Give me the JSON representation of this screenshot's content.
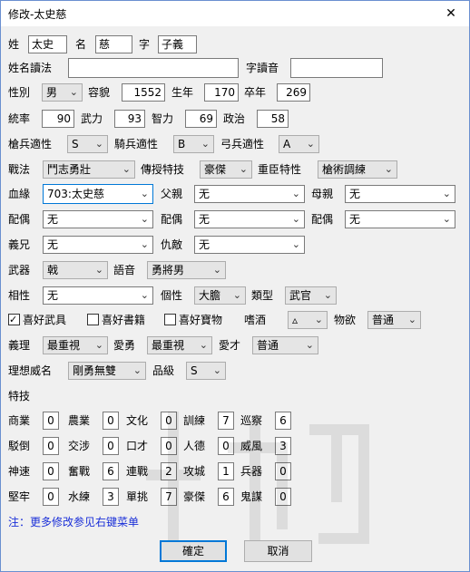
{
  "window": {
    "title": "修改-太史慈",
    "close_glyph": "✕"
  },
  "icons": {
    "dropdown_arrow": "chevron-down-icon",
    "close": "close-icon"
  },
  "row1": {
    "xing_label": "姓",
    "xing": "太史",
    "ming_label": "名",
    "ming": "慈",
    "zi_label": "字",
    "zi": "子義"
  },
  "row2": {
    "name_read_label": "姓名讀法",
    "name_read": "",
    "zi_read_label": "字讀音",
    "zi_read": ""
  },
  "row3": {
    "gender_label": "性別",
    "gender": "男",
    "appearance_label": "容貌",
    "appearance": "1552",
    "birth_label": "生年",
    "birth": "170",
    "death_label": "卒年",
    "death": "269"
  },
  "row4": {
    "lead_label": "統率",
    "lead": "90",
    "war_label": "武力",
    "war": "93",
    "int_label": "智力",
    "int": "69",
    "pol_label": "政治",
    "pol": "58"
  },
  "row5": {
    "spear_label": "槍兵適性",
    "spear": "S",
    "cav_label": "騎兵適性",
    "cav": "B",
    "bow_label": "弓兵適性",
    "bow": "A"
  },
  "row6": {
    "tactic_label": "戰法",
    "tactic": "鬥志勇壯",
    "teach_label": "傳授特技",
    "teach": "豪傑",
    "heavy_label": "重臣特性",
    "heavy": "槍術調練"
  },
  "row7": {
    "blood_label": "血緣",
    "blood": "703:太史慈",
    "father_label": "父親",
    "father": "无",
    "mother_label": "母親",
    "mother": "无"
  },
  "row8": {
    "spouse_label": "配偶",
    "spouse1": "无",
    "spouse2": "无",
    "spouse3": "无"
  },
  "row9": {
    "sworn_label": "義兄",
    "sworn": "无",
    "enemy_label": "仇敵",
    "enemy": "无"
  },
  "row10": {
    "weapon_label": "武器",
    "weapon": "戟",
    "voice_label": "語音",
    "voice": "勇將男"
  },
  "row11": {
    "affinity_label": "相性",
    "affinity": "无",
    "personality_label": "個性",
    "personality": "大膽",
    "type_label": "類型",
    "type": "武官"
  },
  "row12": {
    "like_weapon": "喜好武具",
    "like_weapon_checked": true,
    "like_book": "喜好書籍",
    "like_treasure": "喜好寶物",
    "drink_label": "嗜酒",
    "drink": "▵",
    "desire_label": "物欲",
    "desire": "普通"
  },
  "row13": {
    "justice_label": "義理",
    "justice": "最重視",
    "brave_label": "愛勇",
    "brave": "最重視",
    "talent_label": "愛才",
    "talent": "普通"
  },
  "row14": {
    "ideal_label": "理想威名",
    "ideal": "剛勇無雙",
    "grade_label": "品級",
    "grade": "S"
  },
  "skills": {
    "header": "特技",
    "rows": [
      [
        {
          "name": "商業",
          "value": "0"
        },
        {
          "name": "農業",
          "value": "0"
        },
        {
          "name": "文化",
          "value": "0"
        },
        {
          "name": "訓練",
          "value": "7"
        },
        {
          "name": "巡察",
          "value": "6"
        }
      ],
      [
        {
          "name": "駁倒",
          "value": "0"
        },
        {
          "name": "交涉",
          "value": "0"
        },
        {
          "name": "口才",
          "value": "0"
        },
        {
          "name": "人德",
          "value": "0"
        },
        {
          "name": "威風",
          "value": "3"
        }
      ],
      [
        {
          "name": "神速",
          "value": "0"
        },
        {
          "name": "奮戰",
          "value": "6"
        },
        {
          "name": "連戰",
          "value": "2"
        },
        {
          "name": "攻城",
          "value": "1"
        },
        {
          "name": "兵器",
          "value": "0"
        }
      ],
      [
        {
          "name": "堅牢",
          "value": "0"
        },
        {
          "name": "水練",
          "value": "3"
        },
        {
          "name": "單挑",
          "value": "7"
        },
        {
          "name": "豪傑",
          "value": "6"
        },
        {
          "name": "鬼謀",
          "value": "0"
        }
      ]
    ]
  },
  "note": "注：更多修改参见右键菜单",
  "buttons": {
    "ok": "確定",
    "cancel": "取消"
  }
}
